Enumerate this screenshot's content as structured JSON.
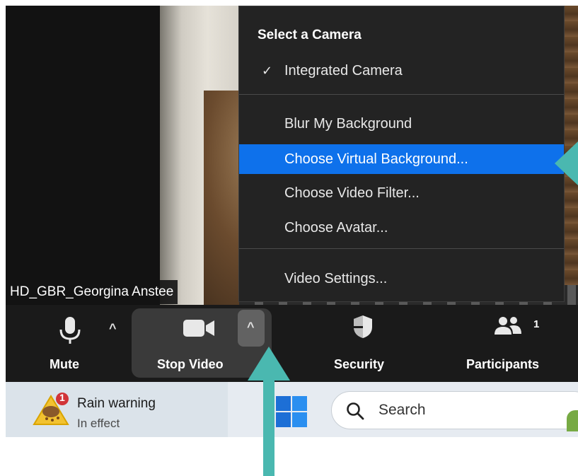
{
  "participant": {
    "name": "HD_GBR_Georgina Anstee"
  },
  "camera_menu": {
    "title": "Select a Camera",
    "camera": "Integrated Camera",
    "items": [
      {
        "label": "Blur My Background",
        "selected": false
      },
      {
        "label": "Choose Virtual Background...",
        "selected": true
      },
      {
        "label": "Choose Video Filter...",
        "selected": false
      },
      {
        "label": "Choose Avatar...",
        "selected": false
      }
    ],
    "settings": "Video Settings..."
  },
  "toolbar": {
    "mute": "Mute",
    "stop_video": "Stop Video",
    "security": "Security",
    "participants": "Participants",
    "participants_count": "1"
  },
  "taskbar": {
    "weather_title": "Rain warning",
    "weather_status": "In effect",
    "weather_badge": "1",
    "search_text": "Search"
  },
  "colors": {
    "menu_highlight": "#0e71eb",
    "annotation_arrow": "#4ab8b0",
    "alert_badge": "#d13438"
  },
  "icons": [
    "microphone-icon",
    "caret-up-icon",
    "video-camera-icon",
    "shield-icon",
    "participants-icon",
    "windows-logo-icon",
    "search-icon",
    "weather-warning-icon",
    "checkmark-icon"
  ]
}
